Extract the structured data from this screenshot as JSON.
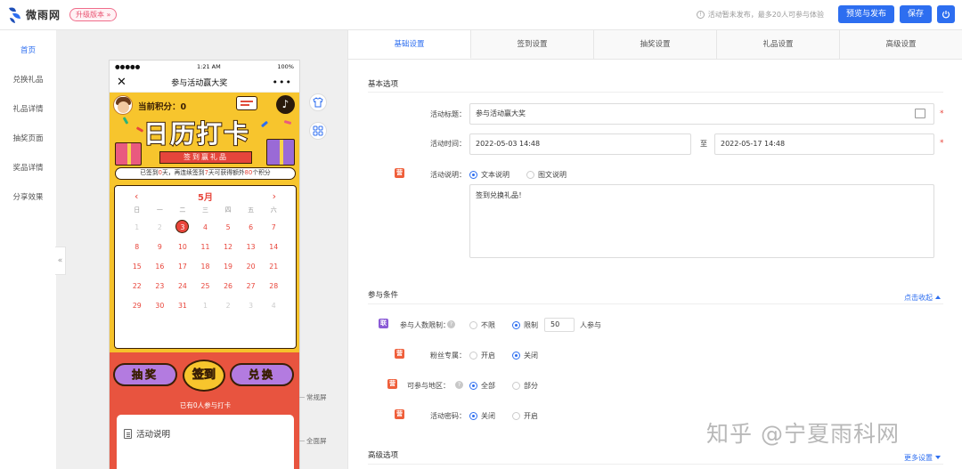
{
  "app": {
    "logo_text": "微雨网",
    "upgrade_label": "升级版本 »"
  },
  "topbar": {
    "notice": "活动暂未发布，最多20人可参与体验",
    "preview_publish": "预览与发布",
    "save": "保存"
  },
  "leftnav": {
    "items": [
      {
        "label": "首页"
      },
      {
        "label": "兑换礼品"
      },
      {
        "label": "礼品详情"
      },
      {
        "label": "抽奖页面"
      },
      {
        "label": "奖品详情"
      },
      {
        "label": "分享效果"
      }
    ],
    "collapse": "«"
  },
  "phone": {
    "status_left": "●●●●●",
    "status_time": "1:21 AM",
    "status_right": "100%",
    "title": "参与活动赢大奖",
    "close": "✕",
    "more": "•••",
    "points_label": "当前积分：",
    "points_value": "0",
    "banner_title": "日历打卡",
    "ribbon": "签到赢礼品",
    "streak": {
      "a": "已签到",
      "n1": "0",
      "b": "天，再连续签到",
      "n2": "7",
      "c": "天可获得额外",
      "n3": "80",
      "d": "个积分"
    },
    "calendar": {
      "month": "5月",
      "prev": "‹",
      "next": "›",
      "weekdays": [
        "日",
        "一",
        "二",
        "三",
        "四",
        "五",
        "六"
      ],
      "rows": [
        [
          "1",
          "2",
          "3",
          "4",
          "5",
          "6",
          "7"
        ],
        [
          "8",
          "9",
          "10",
          "11",
          "12",
          "13",
          "14"
        ],
        [
          "15",
          "16",
          "17",
          "18",
          "19",
          "20",
          "21"
        ],
        [
          "22",
          "23",
          "24",
          "25",
          "26",
          "27",
          "28"
        ],
        [
          "29",
          "30",
          "31",
          "1",
          "2",
          "3",
          "4"
        ]
      ],
      "today": "3"
    },
    "btn_lottery": "抽奖",
    "btn_checkin": "签到",
    "btn_exchange": "兑换",
    "participants": "已有0人参与打卡",
    "desc_title": "活动说明"
  },
  "preview_labels": {
    "normal": "常规屏",
    "full": "全面屏"
  },
  "tabs": [
    {
      "label": "基础设置"
    },
    {
      "label": "签到设置"
    },
    {
      "label": "抽奖设置"
    },
    {
      "label": "礼品设置"
    },
    {
      "label": "高级设置"
    }
  ],
  "basic": {
    "section": "基本选项",
    "title_label": "活动标题：",
    "title_value": "参与活动赢大奖",
    "time_label": "活动时间：",
    "start": "2022-05-03 14:48",
    "to": "至",
    "end": "2022-05-17 14:48",
    "desc_tag": "营",
    "desc_label": "活动说明：",
    "desc_opt_text": "文本说明",
    "desc_opt_rich": "图文说明",
    "desc_value": "签到兑换礼品！",
    "req": "*"
  },
  "conditions": {
    "section": "参与条件",
    "toggle": "点击收起",
    "limit_tag": "联",
    "limit_label": "参与人数限制：",
    "limit_none": "不限",
    "limit_yes": "限制",
    "limit_value": "50",
    "limit_unit": "人参与",
    "fans_tag": "营",
    "fans_label": "粉丝专属：",
    "fans_on": "开启",
    "fans_off": "关闭",
    "region_tag": "营",
    "region_label": "可参与地区：",
    "region_all": "全部",
    "region_part": "部分",
    "pwd_tag": "营",
    "pwd_label": "活动密码：",
    "pwd_off": "关闭",
    "pwd_on": "开启",
    "help": "?"
  },
  "advanced": {
    "section": "高级选项",
    "more": "更多设置"
  },
  "watermark": "知乎 @宁夏雨科网",
  "colors": {
    "accent": "#2d6ef0",
    "red": "#e8453b",
    "yellow": "#f7c52d"
  }
}
